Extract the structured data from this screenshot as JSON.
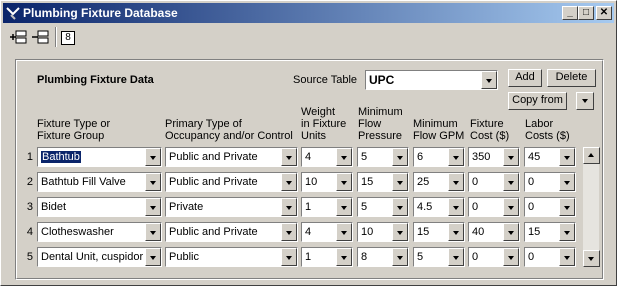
{
  "window": {
    "title": "Plumbing Fixture Database"
  },
  "title_buttons": {
    "minimize": "_",
    "maximize": "□",
    "close": "✕"
  },
  "toolbar": {
    "record_number": "8"
  },
  "panel": {
    "heading": "Plumbing Fixture Data",
    "source_table_label": "Source Table",
    "source_table_value": "UPC",
    "add_label": "Add",
    "delete_label": "Delete",
    "copy_from_label": "Copy from"
  },
  "columns": {
    "fixture": [
      "Fixture Type or",
      "Fixture Group"
    ],
    "occupancy": [
      "Primary Type of",
      "Occupancy and/or Control"
    ],
    "weight": [
      "Weight",
      "in Fixture",
      "Units"
    ],
    "pressure": [
      "Minimum",
      "Flow",
      "Pressure"
    ],
    "gpm": [
      "Minimum",
      "Flow GPM"
    ],
    "fcost": [
      "Fixture",
      "Cost ($)"
    ],
    "lcost": [
      "Labor",
      "Costs ($)"
    ]
  },
  "rows": [
    {
      "num": "1",
      "fixture": "Bathtub",
      "occupancy": "Public and Private",
      "weight": "4",
      "pressure": "5",
      "gpm": "6",
      "fcost": "350",
      "lcost": "45"
    },
    {
      "num": "2",
      "fixture": "Bathtub Fill Valve",
      "occupancy": "Public and Private",
      "weight": "10",
      "pressure": "15",
      "gpm": "25",
      "fcost": "0",
      "lcost": "0"
    },
    {
      "num": "3",
      "fixture": "Bidet",
      "occupancy": "Private",
      "weight": "1",
      "pressure": "5",
      "gpm": "4.5",
      "fcost": "0",
      "lcost": "0"
    },
    {
      "num": "4",
      "fixture": "Clotheswasher",
      "occupancy": "Public and Private",
      "weight": "4",
      "pressure": "10",
      "gpm": "15",
      "fcost": "40",
      "lcost": "15"
    },
    {
      "num": "5",
      "fixture": "Dental Unit, cuspidor",
      "occupancy": "Public",
      "weight": "1",
      "pressure": "8",
      "gpm": "5",
      "fcost": "0",
      "lcost": "0"
    }
  ]
}
